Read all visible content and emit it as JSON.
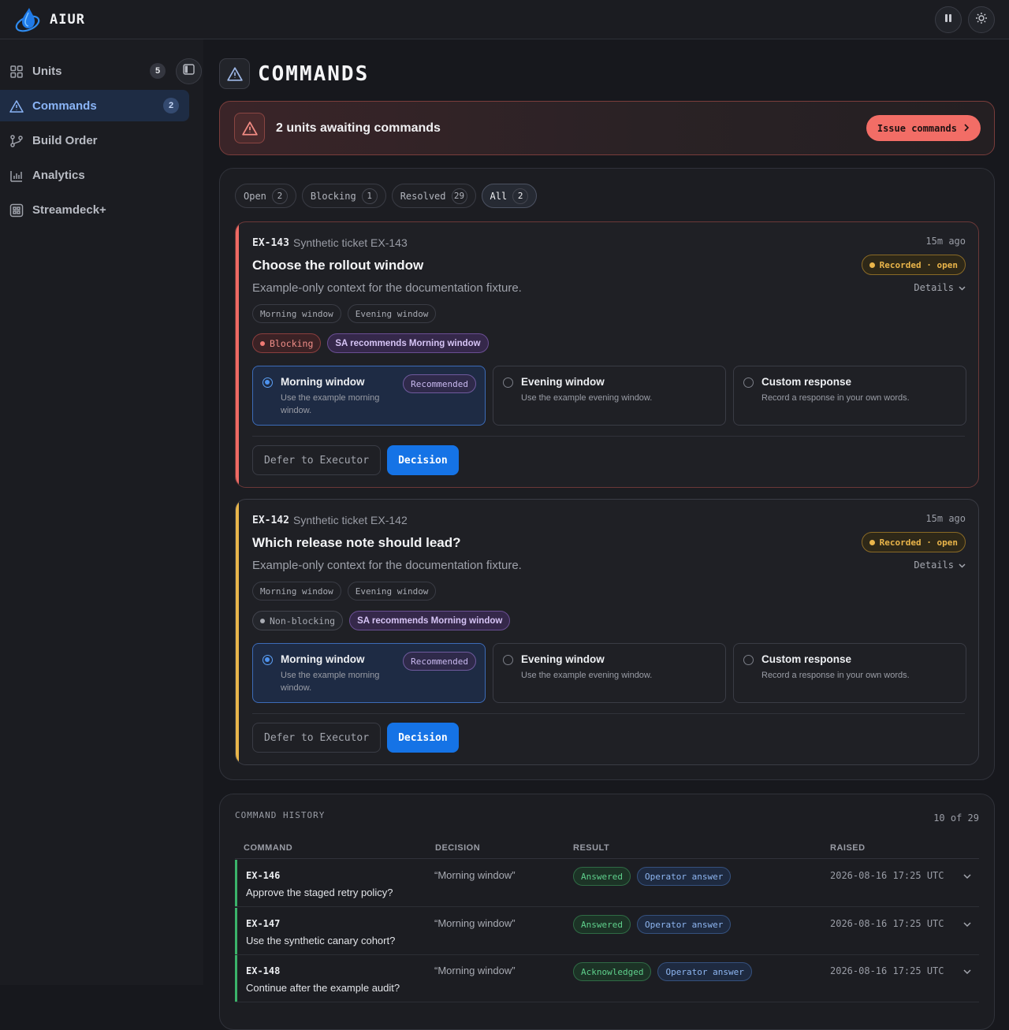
{
  "app": {
    "name": "AIUR"
  },
  "topbar": {
    "pause_icon": "pause-icon",
    "theme_icon": "sun-icon"
  },
  "sidebar": {
    "items": [
      {
        "label": "Units",
        "count": "5",
        "icon": "grid-icon"
      },
      {
        "label": "Commands",
        "count": "2",
        "icon": "warning-triangle-icon"
      },
      {
        "label": "Build Order",
        "icon": "git-branch-icon"
      },
      {
        "label": "Analytics",
        "icon": "bar-chart-icon"
      },
      {
        "label": "Streamdeck+",
        "icon": "keypad-icon"
      }
    ]
  },
  "page": {
    "title": "COMMANDS"
  },
  "alert": {
    "text": "2 units awaiting commands",
    "button": "Issue commands"
  },
  "filters": [
    {
      "label": "Open",
      "count": "2"
    },
    {
      "label": "Blocking",
      "count": "1"
    },
    {
      "label": "Resolved",
      "count": "29"
    },
    {
      "label": "All",
      "count": "2"
    }
  ],
  "tickets": [
    {
      "id": "EX-143",
      "subtitle": "Synthetic ticket EX-143",
      "ago": "15m ago",
      "title": "Choose the rollout window",
      "status": "Recorded · open",
      "context": "Example-only context for the documentation fixture.",
      "details": "Details",
      "tags": [
        "Morning window",
        "Evening window"
      ],
      "priority": "Blocking",
      "sa": "SA recommends Morning window",
      "options": [
        {
          "title": "Morning window",
          "desc": "Use the example morning window.",
          "badge": "Recommended"
        },
        {
          "title": "Evening window",
          "desc": "Use the example evening window."
        },
        {
          "title": "Custom response",
          "desc": "Record a response in your own words."
        }
      ],
      "defer": "Defer to Executor",
      "decide": "Decision"
    },
    {
      "id": "EX-142",
      "subtitle": "Synthetic ticket EX-142",
      "ago": "15m ago",
      "title": "Which release note should lead?",
      "status": "Recorded · open",
      "context": "Example-only context for the documentation fixture.",
      "details": "Details",
      "tags": [
        "Morning window",
        "Evening window"
      ],
      "priority": "Non-blocking",
      "sa": "SA recommends Morning window",
      "options": [
        {
          "title": "Morning window",
          "desc": "Use the example morning window.",
          "badge": "Recommended"
        },
        {
          "title": "Evening window",
          "desc": "Use the example evening window."
        },
        {
          "title": "Custom response",
          "desc": "Record a response in your own words."
        }
      ],
      "defer": "Defer to Executor",
      "decide": "Decision"
    }
  ],
  "history": {
    "title": "COMMAND HISTORY",
    "count": "10 of 29",
    "columns": [
      "COMMAND",
      "DECISION",
      "RESULT",
      "RAISED"
    ],
    "rows": [
      {
        "id": "EX-146",
        "title": "Approve the staged retry policy?",
        "decision": "“Morning window”",
        "result": "Answered",
        "source": "Operator answer",
        "raised": "2026-08-16 17:25 UTC"
      },
      {
        "id": "EX-147",
        "title": "Use the synthetic canary cohort?",
        "decision": "“Morning window”",
        "result": "Answered",
        "source": "Operator answer",
        "raised": "2026-08-16 17:25 UTC"
      },
      {
        "id": "EX-148",
        "title": "Continue after the example audit?",
        "decision": "“Morning window”",
        "result": "Acknowledged",
        "source": "Operator answer",
        "raised": "2026-08-16 17:25 UTC"
      }
    ]
  }
}
